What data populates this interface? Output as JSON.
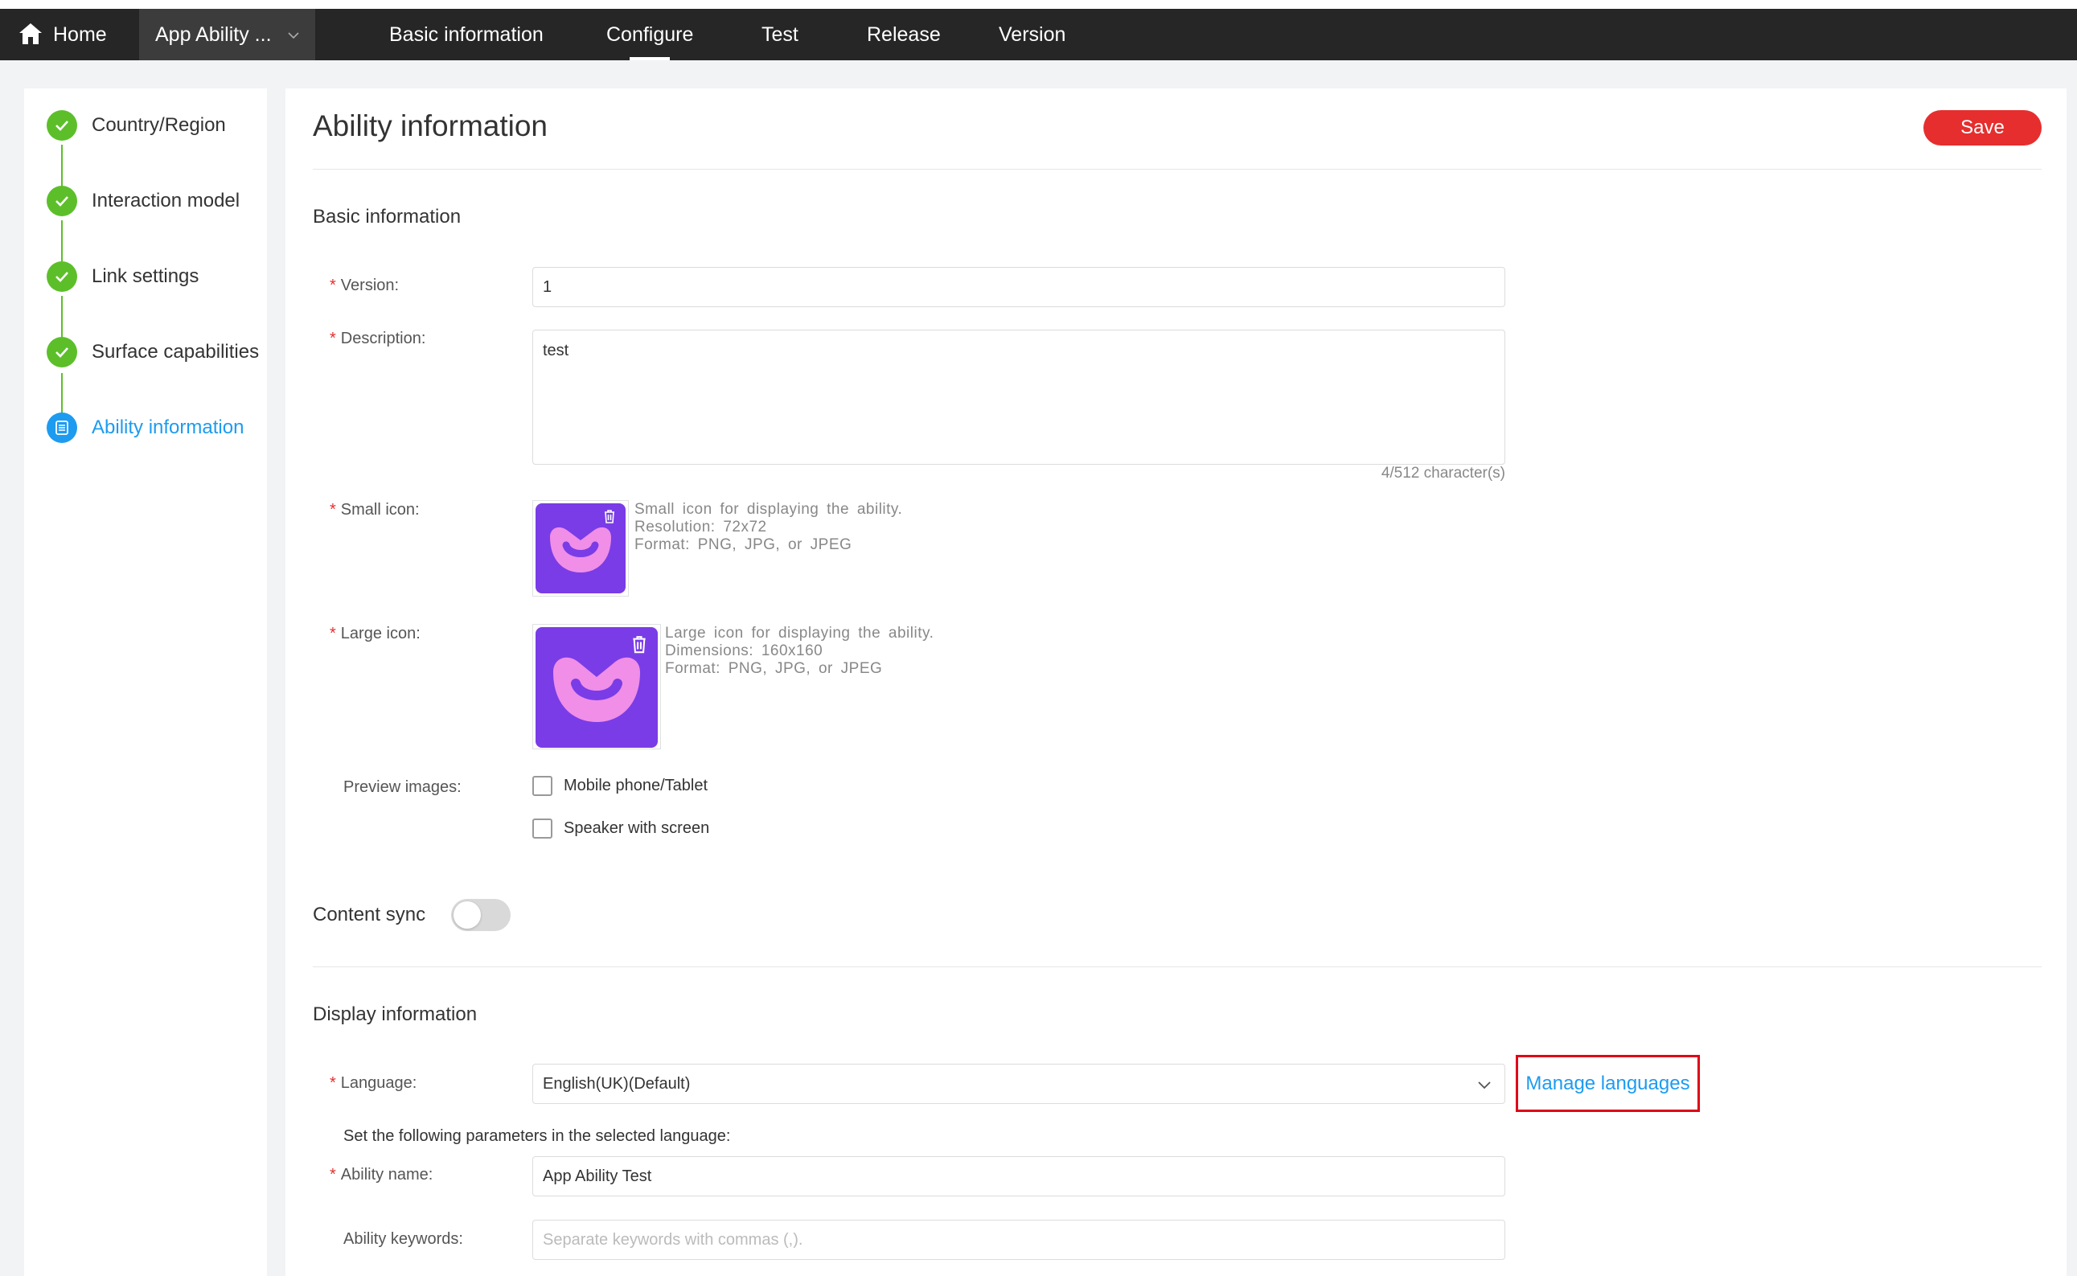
{
  "topbar": {
    "home_label": "Home",
    "app_label": "App Ability ...",
    "nav": [
      "Basic information",
      "Configure",
      "Test",
      "Release",
      "Version"
    ],
    "active_nav": "Configure"
  },
  "sidebar": {
    "steps": [
      {
        "label": "Country/Region",
        "status": "done"
      },
      {
        "label": "Interaction model",
        "status": "done"
      },
      {
        "label": "Link settings",
        "status": "done"
      },
      {
        "label": "Surface capabilities",
        "status": "done"
      },
      {
        "label": "Ability information",
        "status": "active"
      }
    ]
  },
  "main": {
    "title": "Ability information",
    "save_label": "Save",
    "basic_section": "Basic information",
    "version": {
      "label": "Version:",
      "value": "1"
    },
    "description": {
      "label": "Description:",
      "value": "test",
      "counter": "4/512 character(s)"
    },
    "small_icon": {
      "label": "Small icon:",
      "hint": [
        "Small icon for displaying the ability.",
        "Resolution: 72x72",
        "Format: PNG, JPG, or JPEG"
      ]
    },
    "large_icon": {
      "label": "Large icon:",
      "hint": [
        "Large icon for displaying the ability.",
        "Dimensions: 160x160",
        "Format: PNG, JPG, or JPEG"
      ]
    },
    "preview": {
      "label": "Preview images:",
      "options": [
        "Mobile phone/Tablet",
        "Speaker with screen"
      ]
    },
    "content_sync": {
      "label": "Content sync",
      "enabled": false
    },
    "display_section": "Display information",
    "language": {
      "label": "Language:",
      "value": "English(UK)(Default)",
      "manage_label": "Manage languages"
    },
    "lang_note": "Set the following parameters in the selected language:",
    "ability_name": {
      "label": "Ability name:",
      "value": "App Ability Test"
    },
    "ability_keywords": {
      "label": "Ability keywords:",
      "placeholder": "Separate keywords with commas (,)."
    }
  },
  "colors": {
    "accent": "#1d9bf0",
    "done": "#5cbf2a",
    "save": "#e62e2e",
    "icon_bg": "#7a3ce6",
    "icon_fg": "#f08ee8"
  }
}
